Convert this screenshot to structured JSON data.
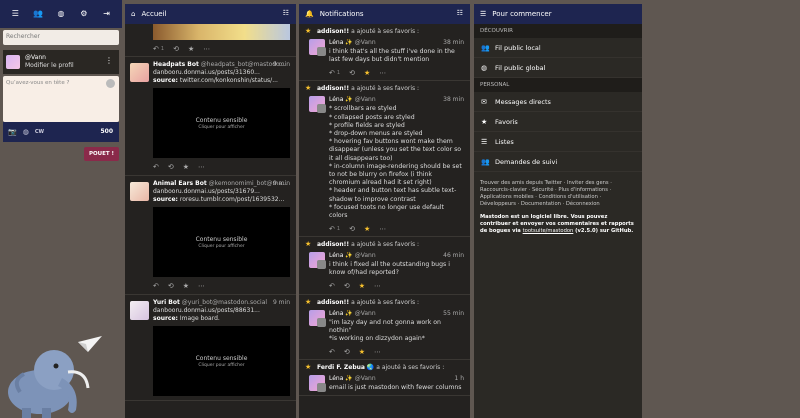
{
  "drawer": {
    "search_placeholder": "Rechercher",
    "account": {
      "username": "@Vann",
      "edit_profile": "Modifier le profil"
    },
    "compose_placeholder": "Qu’avez-vous en tête ?",
    "cw_label": "CW",
    "char_count": "500",
    "post_button": "POUET !"
  },
  "columns": {
    "home": {
      "title": "Accueil",
      "statuses": [
        {
          "name": "Headpats Bot",
          "handle": "@headpats_bot@mastodo...",
          "time": "9 min",
          "line1": "danbooru.donmai.us/posts/31360...",
          "source_label": "source:",
          "source": "twitter.com/konkonshin/status/...",
          "sensitive_label": "Contenu sensible",
          "sensitive_hint": "Cliquer pour afficher"
        },
        {
          "name": "Animal Ears Bot",
          "handle": "@kemonomimi_bot@ma...",
          "time": "9 min",
          "line1": "danbooru.donmai.us/posts/31679...",
          "source_label": "source:",
          "source": "roresu.tumblr.com/post/1639532...",
          "sensitive_label": "Contenu sensible",
          "sensitive_hint": "Cliquer pour afficher"
        },
        {
          "name": "Yuri Bot",
          "handle": "@yuri_bot@mastodon.social",
          "time": "9 min",
          "line1": "danbooru.donmai.us/posts/88631...",
          "source_label": "source:",
          "source": "Image board.",
          "sensitive_label": "Contenu sensible",
          "sensitive_hint": "Cliquer pour afficher"
        }
      ],
      "reply_count": "1"
    },
    "notifications": {
      "title": "Notifications",
      "items": [
        {
          "who": "addison!!",
          "action": "a ajouté à ses favoris :",
          "author": "Léna",
          "handle": "@Vann",
          "time": "38 min",
          "text": "i think that's all the stuff i've done in the last few days but didn't mention"
        },
        {
          "who": "addison!!",
          "action": "a ajouté à ses favoris :",
          "author": "Léna",
          "handle": "@Vann",
          "time": "38 min",
          "text": "* scrollbars are styled\n* collapsed posts are styled\n* profile fields are styled\n* drop-down menus are styled\n* hovering fav buttons wont make them disappear (unless you set the text color so it all disappears too)\n* in-column image-rendering should be set to not be blurry on firefox (i think chromium alread had it set right)\n* header and button text has subtle text-shadow to improve contrast\n* focused toots no longer use default colors"
        },
        {
          "who": "addison!!",
          "action": "a ajouté à ses favoris :",
          "author": "Léna",
          "handle": "@Vann",
          "time": "46 min",
          "text": "i think i fixed all the outstanding bugs i know of/had reported?"
        },
        {
          "who": "addison!!",
          "action": "a ajouté à ses favoris :",
          "author": "Léna",
          "handle": "@Vann",
          "time": "55 min",
          "text": "\"im lazy day and not gonna work on nothin\"\n*is working on dizzydon again*"
        },
        {
          "who": "Ferdi F. Zebua",
          "action": "a ajouté à ses favoris :",
          "author": "Léna",
          "handle": "@Vann",
          "time": "1 h",
          "text": "email is just mastodon with fewer columns"
        }
      ]
    },
    "getting_started": {
      "title": "Pour commencer",
      "discover_label": "Découvrir",
      "discover_items": [
        "Fil public local",
        "Fil public global"
      ],
      "personal_label": "Personal",
      "personal_items": [
        "Messages directs",
        "Favoris",
        "Listes",
        "Demandes de suivi"
      ],
      "footer_links": "Trouver des amis depuis Twitter · Inviter des gens · Raccourcis-clavier · Sécurité · Plus d'informations · Applications mobiles · Conditions d'utilisation · Développeurs · Documentation · Déconnexion",
      "footer_note_a": "Mastodon est un logiciel libre. Vous pouvez contribuer et envoyer vos commentaires et rapports de bogues via ",
      "footer_repo": "tootsuite/mastodon",
      "footer_note_b": " (v2.5.0) sur GitHub."
    }
  }
}
